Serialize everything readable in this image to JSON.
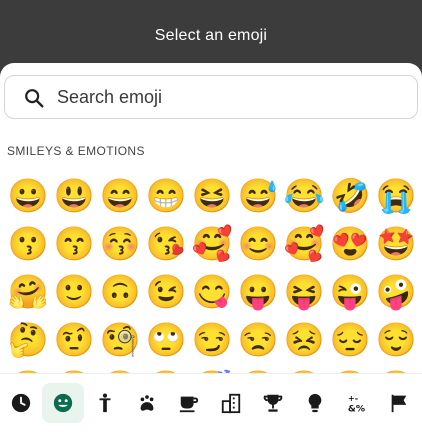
{
  "header": {
    "title": "Select an emoji"
  },
  "search": {
    "placeholder": "Search emoji"
  },
  "section": {
    "title": "SMILEYS & EMOTIONS"
  },
  "emojis": [
    "😀",
    "😃",
    "😄",
    "😁",
    "😆",
    "😅",
    "😂",
    "🤣",
    "😭",
    "😗",
    "😙",
    "😚",
    "😘",
    "🥰",
    "😊",
    "🥰",
    "😍",
    "🤩",
    "🤗",
    "🙂",
    "🙃",
    "😉",
    "😋",
    "😛",
    "😝",
    "😜",
    "🤪",
    "🤔",
    "🤨",
    "🧐",
    "🙄",
    "😏",
    "😒",
    "😣",
    "😔",
    "😌",
    "😐",
    "😑",
    "😶",
    "😏",
    "😴",
    "😪",
    "😵",
    "😞",
    "😟"
  ],
  "tabs": [
    {
      "name": "recent-tab",
      "icon": "clock-icon"
    },
    {
      "name": "smileys-tab",
      "icon": "smiley-icon",
      "active": true
    },
    {
      "name": "people-tab",
      "icon": "person-icon"
    },
    {
      "name": "animals-tab",
      "icon": "paw-icon"
    },
    {
      "name": "food-tab",
      "icon": "cup-icon"
    },
    {
      "name": "travel-tab",
      "icon": "building-icon"
    },
    {
      "name": "activities-tab",
      "icon": "trophy-icon"
    },
    {
      "name": "objects-tab",
      "icon": "lightbulb-icon"
    },
    {
      "name": "symbols-tab",
      "icon": "symbols-icon"
    },
    {
      "name": "flags-tab",
      "icon": "flag-icon"
    }
  ],
  "colors": {
    "header_bg": "#3c3c3c",
    "active_tab_bg": "#e9f4ef"
  }
}
